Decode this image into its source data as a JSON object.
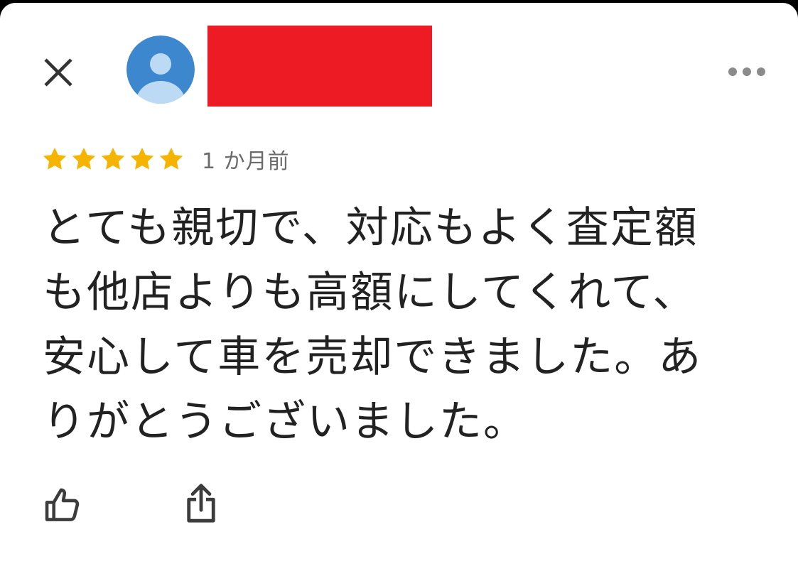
{
  "header": {
    "close_icon": "close-icon",
    "avatar_icon": "person-avatar-icon",
    "avatar_bg": "#3d87cf",
    "avatar_fg": "#bcdaf4",
    "redaction_color": "#ed1c24",
    "more_icon": "more-horizontal-icon"
  },
  "review": {
    "rating": 5,
    "rating_max": 5,
    "star_color": "#f4b400",
    "time_ago": "1 か月前",
    "text": "とても親切で、対応もよく査定額も他店よりも高額にしてくれて、安心して車を売却できました。ありがとうございました。"
  },
  "actions": {
    "like_icon": "thumbs-up-icon",
    "share_icon": "share-icon"
  }
}
